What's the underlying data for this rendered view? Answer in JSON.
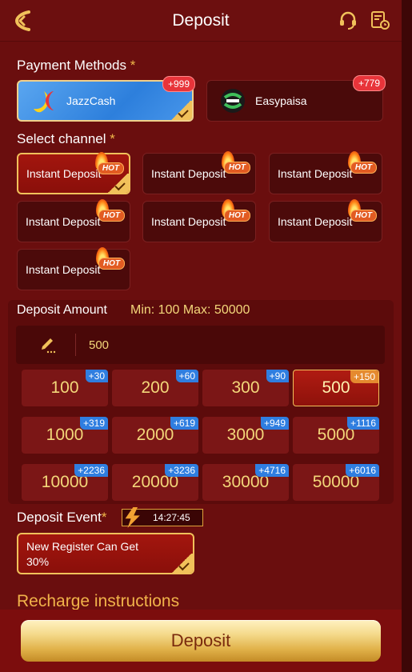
{
  "header": {
    "title": "Deposit"
  },
  "payment_methods": {
    "label": "Payment Methods",
    "required_mark": "*",
    "items": [
      {
        "name": "JazzCash",
        "badge": "+999",
        "selected": true
      },
      {
        "name": "Easypaisa",
        "badge": "+779",
        "selected": false
      }
    ]
  },
  "channel": {
    "label": "Select channel",
    "required_mark": "*",
    "items": [
      {
        "label": "Instant Deposit",
        "tag": "HOT",
        "selected": true
      },
      {
        "label": "Instant Deposit",
        "tag": "HOT",
        "selected": false
      },
      {
        "label": "Instant Deposit",
        "tag": "HOT",
        "selected": false
      },
      {
        "label": "Instant Deposit",
        "tag": "HOT",
        "selected": false
      },
      {
        "label": "Instant Deposit",
        "tag": "HOT",
        "selected": false
      },
      {
        "label": "Instant Deposit",
        "tag": "HOT",
        "selected": false
      },
      {
        "label": "Instant Deposit",
        "tag": "HOT",
        "selected": false
      }
    ]
  },
  "amount": {
    "label": "Deposit Amount",
    "min_max": "Min: 100  Max: 50000",
    "input_value": "500",
    "options": [
      {
        "value": "100",
        "bonus": "+30",
        "selected": false
      },
      {
        "value": "200",
        "bonus": "+60",
        "selected": false
      },
      {
        "value": "300",
        "bonus": "+90",
        "selected": false
      },
      {
        "value": "500",
        "bonus": "+150",
        "selected": true
      },
      {
        "value": "1000",
        "bonus": "+319",
        "selected": false
      },
      {
        "value": "2000",
        "bonus": "+619",
        "selected": false
      },
      {
        "value": "3000",
        "bonus": "+949",
        "selected": false
      },
      {
        "value": "5000",
        "bonus": "+1116",
        "selected": false
      },
      {
        "value": "10000",
        "bonus": "+2236",
        "selected": false
      },
      {
        "value": "20000",
        "bonus": "+3236",
        "selected": false
      },
      {
        "value": "30000",
        "bonus": "+4716",
        "selected": false
      },
      {
        "value": "50000",
        "bonus": "+6016",
        "selected": false
      }
    ]
  },
  "event": {
    "label": "Deposit Event",
    "required_mark": "*",
    "timer": "14:27:45",
    "card_line1": "New Register Can Get",
    "card_line2": "30%"
  },
  "recharge_instructions": "Recharge instructions",
  "footer": {
    "deposit_label": "Deposit"
  },
  "icons": {
    "back": "back-arrow-icon",
    "support": "headset-icon",
    "history": "history-icon",
    "edit": "pencil-icon",
    "flame": "flame-icon",
    "bolt": "lightning-icon"
  },
  "colors": {
    "background": "#6a0e0e",
    "accent_gold": "#f1c15a",
    "bonus_blue": "#2f7ee0",
    "badge_red": "#e8343a"
  }
}
